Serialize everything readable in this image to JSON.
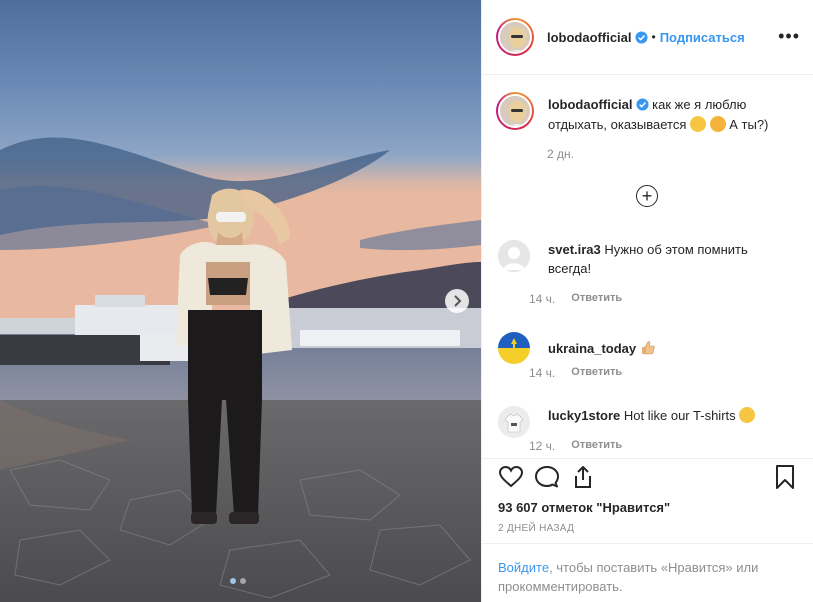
{
  "post": {
    "username": "lobodaofficial",
    "separator": "•",
    "follow_label": "Подписаться",
    "more_label": "•••",
    "caption_text": "как же я люблю отдыхать, оказывается",
    "caption_end": "А ты?)",
    "caption_time": "2 дн.",
    "load_more_label": "+",
    "likes_text": "93 607 отметок \"Нравится\"",
    "posted_ago": "2 ДНЕЙ НАЗАД",
    "login_link": "Войдите",
    "login_text": ", чтобы поставить «Нравится» или прокомментировать.",
    "carousel": {
      "index": 1,
      "count": 2
    }
  },
  "comments": [
    {
      "username": "svet.ira3",
      "text": "Нужно об этом помнить всегда!",
      "time": "14 ч.",
      "reply": "Ответить"
    },
    {
      "username": "ukraina_today",
      "text": "",
      "time": "14 ч.",
      "reply": "Ответить"
    },
    {
      "username": "lucky1store",
      "text": "Hot like our T-shirts",
      "time": "12 ч.",
      "reply": "Ответить"
    }
  ],
  "icons": [
    "heart-icon",
    "comment-icon",
    "share-icon",
    "bookmark-icon",
    "verified-badge-icon",
    "chevron-right-icon"
  ],
  "colors": {
    "link": "#3897f0",
    "muted": "#8e8e8e",
    "text": "#262626"
  }
}
